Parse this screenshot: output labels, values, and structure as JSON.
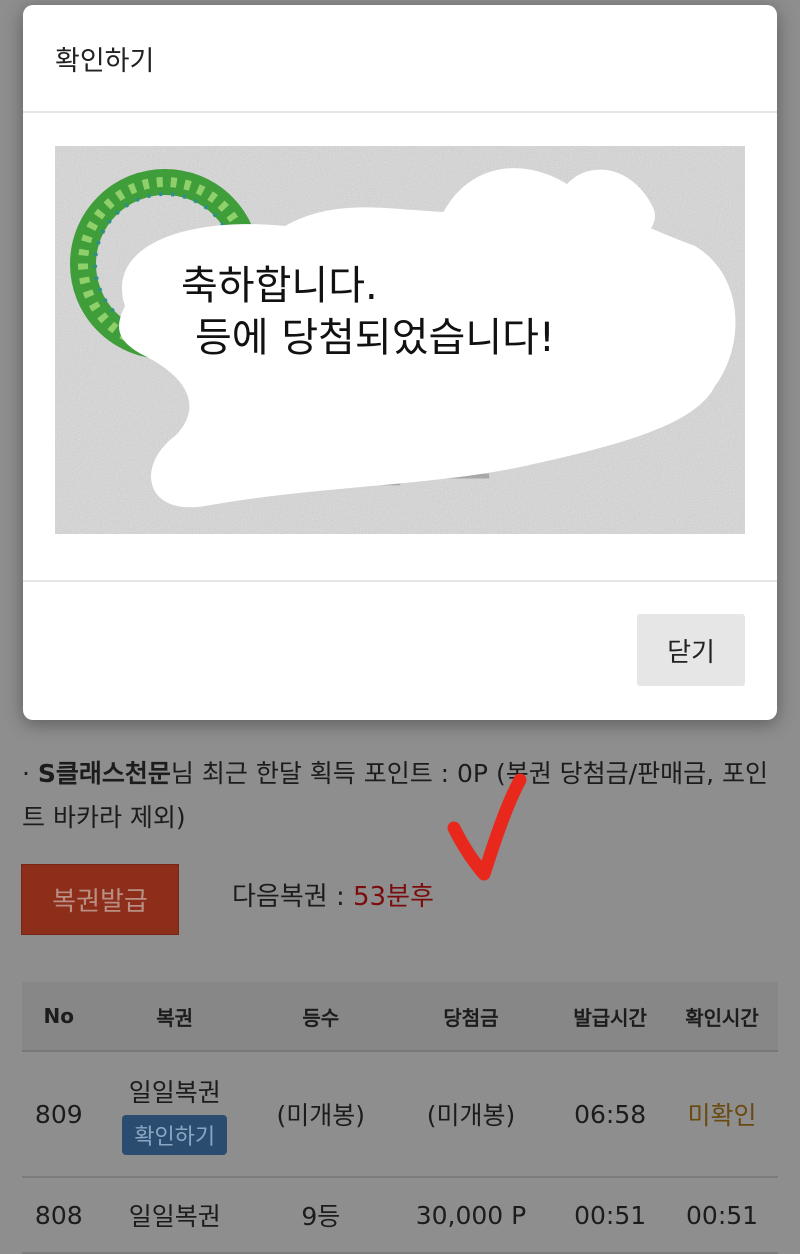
{
  "modal": {
    "title": "확인하기",
    "message_line1": "축하합니다.",
    "message_line2": "등에 당첨되었습니다!",
    "close_label": "닫기"
  },
  "page": {
    "points_prefix": "· ",
    "points_username": "S클래스천문",
    "points_text": "님 최근 한달 획득 포인트 : 0P (복권 당첨금/판매금, 포인트 바카라 제외)",
    "issue_button": "복권발급",
    "next_label": "다음복권 : ",
    "next_value": "53분후"
  },
  "table": {
    "headers": [
      "No",
      "복권",
      "등수",
      "당첨금",
      "발급시간",
      "확인시간"
    ],
    "rows": [
      {
        "no": "809",
        "name": "일일복권",
        "action": "확인하기",
        "rank": "(미개봉)",
        "prize": "(미개봉)",
        "issued": "06:58",
        "checked": "미확인"
      },
      {
        "no": "808",
        "name": "일일복권",
        "rank": "9등",
        "prize": "30,000 P",
        "issued": "00:51",
        "checked": "00:51"
      }
    ]
  },
  "colors": {
    "accent_red": "#7a0c0c",
    "issue_button_bg": "#8c2e1a",
    "unchecked_orange": "#6a4a10",
    "annotation_check": "#e8281c"
  }
}
